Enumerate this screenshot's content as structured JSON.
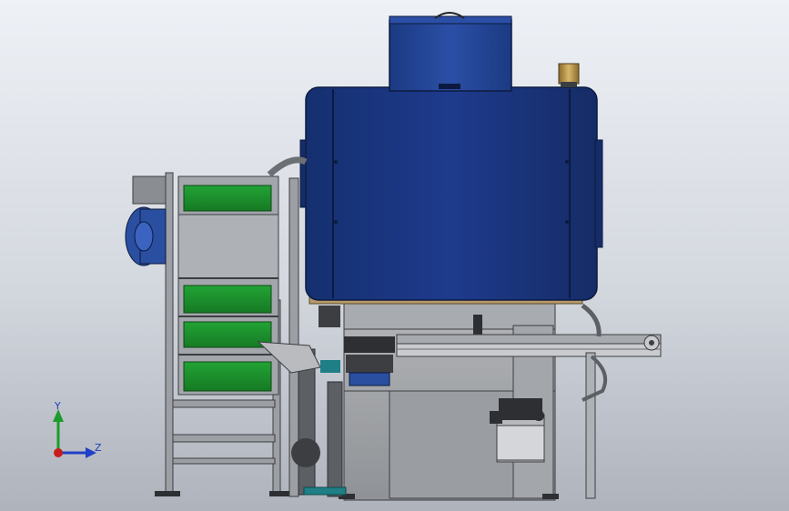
{
  "triad": {
    "y_label": "Y",
    "z_label": "Z",
    "colors": {
      "y_axis": "#1c9c2c",
      "z_axis": "#2040c8",
      "x_axis": "#c81c1c"
    }
  },
  "colors": {
    "background_top": "#eef1f6",
    "background_bottom": "#aeb3bc",
    "hopper_blue": "#1e3a8c",
    "belt_green": "#1a8a2a",
    "frame_grey": "#9c9fa4",
    "motor_blue": "#2a4fa0",
    "flange_tan": "#b89a6a",
    "teal_fitting": "#1e7f86"
  }
}
